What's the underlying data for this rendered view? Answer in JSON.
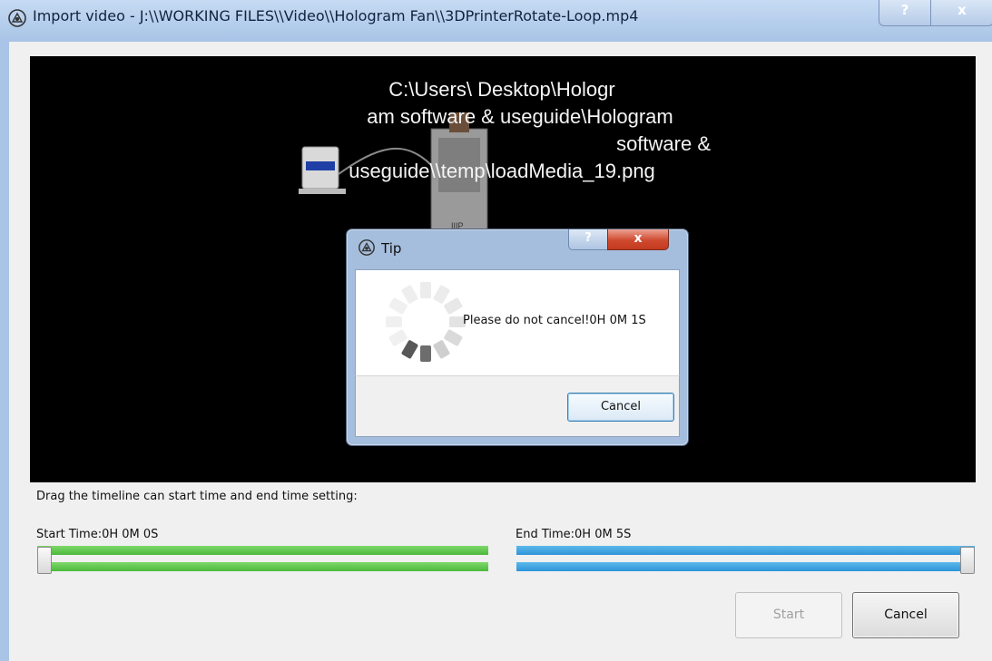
{
  "window": {
    "title": "Import video - J:\\\\WORKING FILES\\\\Video\\\\Hologram Fan\\\\3DPrinterRotate-Loop.mp4",
    "help_label": "?",
    "close_label": "x"
  },
  "preview": {
    "path_lines": [
      "C:\\Users\\ Desktop\\Hologr",
      "am software & useguide\\Hologram",
      "software &",
      "useguide\\\\temp\\loadMedia_19.png"
    ],
    "image_icon": "3d-printer-image"
  },
  "tip_dialog": {
    "title": "Tip",
    "help_label": "?",
    "close_label": "x",
    "message": "Please do not cancel!0H 0M 1S",
    "cancel_label": "Cancel",
    "spinner_icon": "loading-spinner-icon"
  },
  "timeline": {
    "hint": "Drag the timeline can start time and end time setting:",
    "start_label": "Start Time:0H 0M 0S",
    "end_label": "End Time:0H 0M 5S",
    "start_position": 0.0,
    "end_position": 1.0,
    "start_color": "#4bb83c",
    "end_color": "#2f94d8"
  },
  "actions": {
    "start_label": "Start",
    "cancel_label": "Cancel"
  }
}
